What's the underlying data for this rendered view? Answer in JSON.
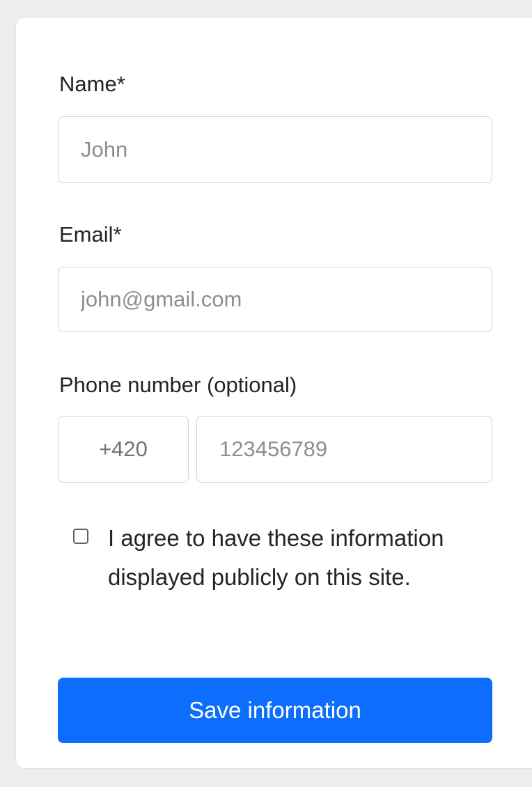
{
  "form": {
    "name": {
      "label": "Name*",
      "placeholder": "John",
      "value": ""
    },
    "email": {
      "label": "Email*",
      "placeholder": "john@gmail.com",
      "value": ""
    },
    "phone": {
      "label": "Phone number (optional)",
      "prefix": "+420",
      "placeholder": "123456789",
      "value": ""
    },
    "consent": {
      "checked": false,
      "label": "I agree to have these information displayed publicly on this site."
    },
    "submit_label": "Save information"
  },
  "colors": {
    "primary": "#0d6efd",
    "border": "#ced4da",
    "placeholder": "#8a8f94",
    "text": "#212529",
    "page_background": "#ecedef"
  }
}
